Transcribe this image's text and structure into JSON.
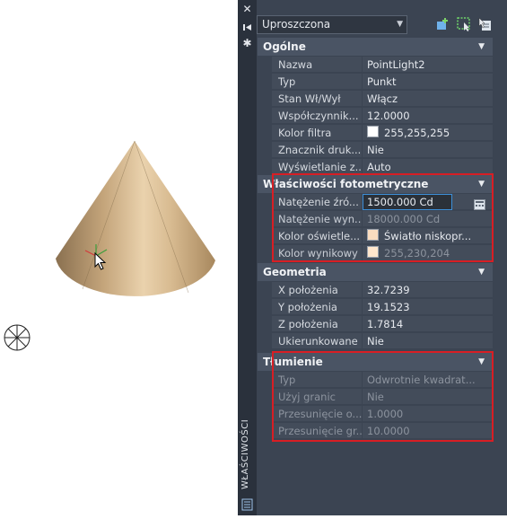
{
  "panel": {
    "side_title": "WŁAŚCIWOŚCI",
    "selector_value": "Uproszczona"
  },
  "sections": {
    "general": {
      "title": "Ogólne",
      "rows": [
        {
          "label": "Nazwa",
          "value": "PointLight2"
        },
        {
          "label": "Typ",
          "value": "Punkt"
        },
        {
          "label": "Stan Wł/Wył",
          "value": "Włącz"
        },
        {
          "label": "Współczynnik...",
          "value": "12.0000"
        },
        {
          "label": "Kolor filtra",
          "value": "255,255,255",
          "swatch": "#ffffff"
        },
        {
          "label": "Znacznik druk...",
          "value": "Nie"
        },
        {
          "label": "Wyświetlanie z...",
          "value": "Auto"
        }
      ]
    },
    "photometric": {
      "title": "Właściwości fotometryczne",
      "rows": [
        {
          "label": "Natężenie źró...",
          "value": "1500.000 Cd"
        },
        {
          "label": "Natężenie wyn...",
          "value": "18000.000 Cd"
        },
        {
          "label": "Kolor oświetle...",
          "value": "Światło niskopr...",
          "swatch": "#f9dcbf"
        },
        {
          "label": "Kolor wynikowy",
          "value": "255,230,204",
          "swatch": "#ffe6cc"
        }
      ]
    },
    "geometry": {
      "title": "Geometria",
      "rows": [
        {
          "label": "X położenia",
          "value": "32.7239"
        },
        {
          "label": "Y położenia",
          "value": "19.1523"
        },
        {
          "label": "Z położenia",
          "value": "1.7814"
        },
        {
          "label": "Ukierunkowane",
          "value": "Nie"
        }
      ]
    },
    "attenuation": {
      "title": "Tłumienie",
      "rows": [
        {
          "label": "Typ",
          "value": "Odwrotnie kwadrat..."
        },
        {
          "label": "Użyj granic",
          "value": "Nie"
        },
        {
          "label": "Przesunięcie o...",
          "value": "1.0000"
        },
        {
          "label": "Przesunięcie gr...",
          "value": "10.0000"
        }
      ]
    }
  },
  "colors": {
    "highlight": "#d81e24",
    "panel_bg": "#3b4452",
    "cone": "#c9ab84"
  },
  "icons": [
    "close-icon",
    "pin-icon",
    "settings-icon",
    "quick-select-icon",
    "select-objects-icon",
    "toggle-pickadd-icon",
    "calculator-icon",
    "properties-icon",
    "point-light-glyph-icon",
    "cursor-icon",
    "ucs-icon"
  ]
}
